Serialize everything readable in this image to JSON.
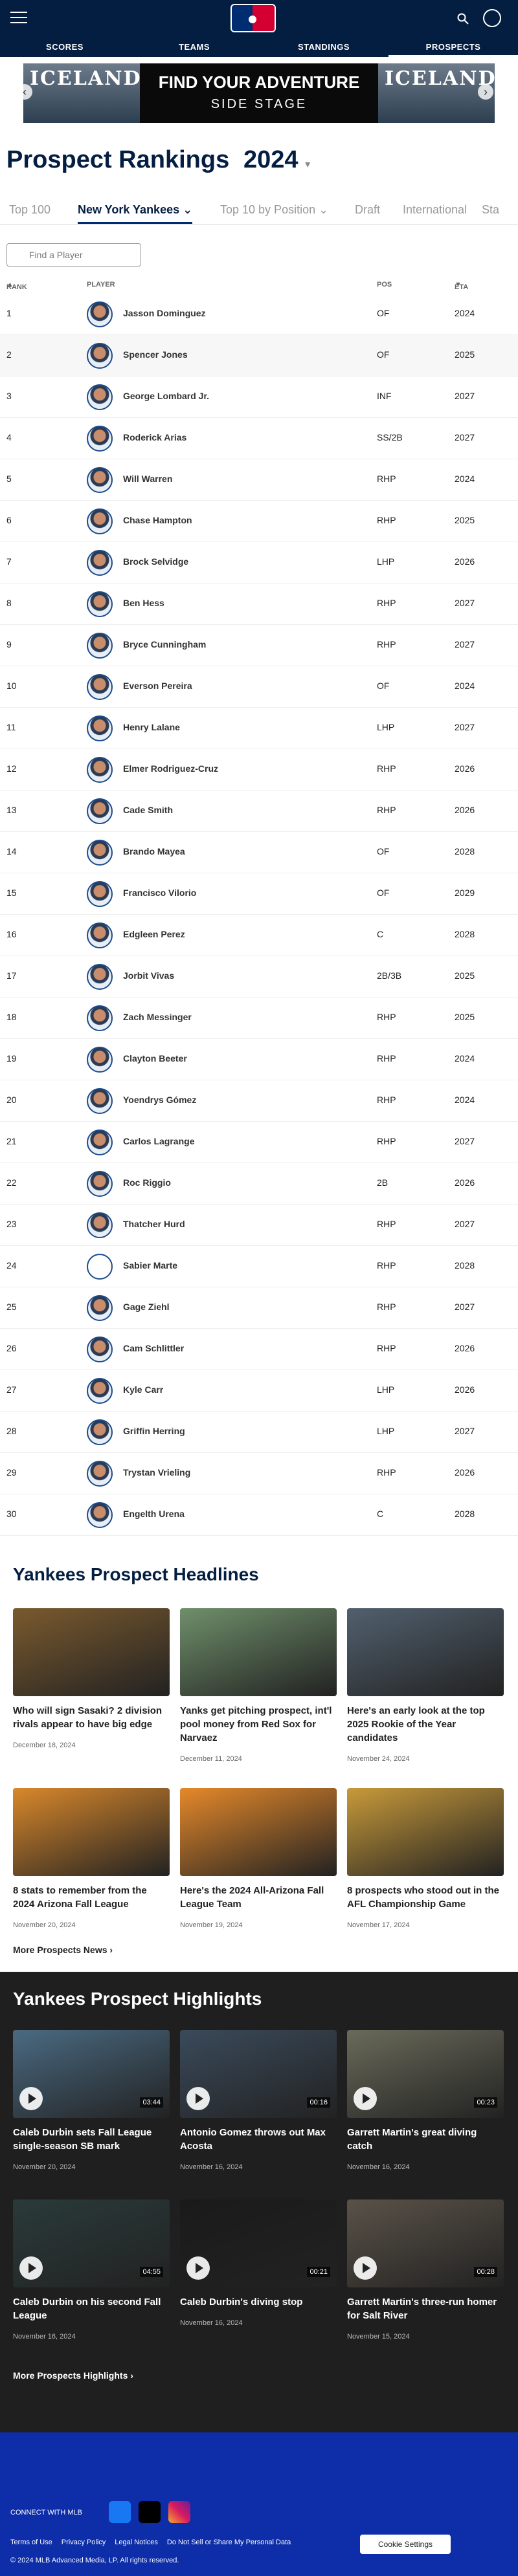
{
  "nav": {
    "items": [
      "SCORES",
      "TEAMS",
      "STANDINGS",
      "PROSPECTS"
    ],
    "active_index": 3
  },
  "banner": {
    "brand_left": "ICELAND",
    "headline": "FIND YOUR ADVENTURE",
    "sub": "SIDE STAGE",
    "brand_right": "ICELAND"
  },
  "page": {
    "title": "Prospect Rankings",
    "year": "2024"
  },
  "tabs": [
    "Top 100",
    "New York Yankees",
    "Top 10 by Position",
    "Draft",
    "International",
    "Sta"
  ],
  "search": {
    "placeholder": "Find a Player"
  },
  "table": {
    "headers": {
      "rank": "RANK",
      "player": "PLAYER",
      "pos": "POS",
      "eta": "ETA"
    },
    "rows": [
      {
        "rank": "1",
        "name": "Jasson Dominguez",
        "pos": "OF",
        "eta": "2024"
      },
      {
        "rank": "2",
        "name": "Spencer Jones",
        "pos": "OF",
        "eta": "2025"
      },
      {
        "rank": "3",
        "name": "George Lombard Jr.",
        "pos": "INF",
        "eta": "2027"
      },
      {
        "rank": "4",
        "name": "Roderick Arias",
        "pos": "SS/2B",
        "eta": "2027"
      },
      {
        "rank": "5",
        "name": "Will Warren",
        "pos": "RHP",
        "eta": "2024"
      },
      {
        "rank": "6",
        "name": "Chase Hampton",
        "pos": "RHP",
        "eta": "2025"
      },
      {
        "rank": "7",
        "name": "Brock Selvidge",
        "pos": "LHP",
        "eta": "2026"
      },
      {
        "rank": "8",
        "name": "Ben Hess",
        "pos": "RHP",
        "eta": "2027"
      },
      {
        "rank": "9",
        "name": "Bryce Cunningham",
        "pos": "RHP",
        "eta": "2027"
      },
      {
        "rank": "10",
        "name": "Everson Pereira",
        "pos": "OF",
        "eta": "2024"
      },
      {
        "rank": "11",
        "name": "Henry Lalane",
        "pos": "LHP",
        "eta": "2027"
      },
      {
        "rank": "12",
        "name": "Elmer Rodriguez-Cruz",
        "pos": "RHP",
        "eta": "2026"
      },
      {
        "rank": "13",
        "name": "Cade Smith",
        "pos": "RHP",
        "eta": "2026"
      },
      {
        "rank": "14",
        "name": "Brando Mayea",
        "pos": "OF",
        "eta": "2028"
      },
      {
        "rank": "15",
        "name": "Francisco Vilorio",
        "pos": "OF",
        "eta": "2029"
      },
      {
        "rank": "16",
        "name": "Edgleen Perez",
        "pos": "C",
        "eta": "2028"
      },
      {
        "rank": "17",
        "name": "Jorbit Vivas",
        "pos": "2B/3B",
        "eta": "2025"
      },
      {
        "rank": "18",
        "name": "Zach Messinger",
        "pos": "RHP",
        "eta": "2025"
      },
      {
        "rank": "19",
        "name": "Clayton Beeter",
        "pos": "RHP",
        "eta": "2024"
      },
      {
        "rank": "20",
        "name": "Yoendrys Gómez",
        "pos": "RHP",
        "eta": "2024"
      },
      {
        "rank": "21",
        "name": "Carlos Lagrange",
        "pos": "RHP",
        "eta": "2027"
      },
      {
        "rank": "22",
        "name": "Roc Riggio",
        "pos": "2B",
        "eta": "2026"
      },
      {
        "rank": "23",
        "name": "Thatcher Hurd",
        "pos": "RHP",
        "eta": "2027"
      },
      {
        "rank": "24",
        "name": "Sabier Marte",
        "pos": "RHP",
        "eta": "2028"
      },
      {
        "rank": "25",
        "name": "Gage Ziehl",
        "pos": "RHP",
        "eta": "2027"
      },
      {
        "rank": "26",
        "name": "Cam Schlittler",
        "pos": "RHP",
        "eta": "2026"
      },
      {
        "rank": "27",
        "name": "Kyle Carr",
        "pos": "LHP",
        "eta": "2026"
      },
      {
        "rank": "28",
        "name": "Griffin Herring",
        "pos": "LHP",
        "eta": "2027"
      },
      {
        "rank": "29",
        "name": "Trystan Vrieling",
        "pos": "RHP",
        "eta": "2026"
      },
      {
        "rank": "30",
        "name": "Engelth Urena",
        "pos": "C",
        "eta": "2028"
      }
    ]
  },
  "headlines": {
    "title": "Yankees Prospect Headlines",
    "items": [
      {
        "title": "Who will sign Sasaki? 2 division rivals appear to have big edge",
        "date": "December 18, 2024",
        "color": "#7a5a2e"
      },
      {
        "title": "Yanks get pitching prospect, int'l pool money from Red Sox for Narvaez",
        "date": "December 11, 2024",
        "color": "#6f8f6a"
      },
      {
        "title": "Here's an early look at the top 2025 Rookie of the Year candidates",
        "date": "November 24, 2024",
        "color": "#51606e"
      },
      {
        "title": "8 stats to remember from the 2024 Arizona Fall League",
        "date": "November 20, 2024",
        "color": "#d9882b"
      },
      {
        "title": "Here's the 2024 All-Arizona Fall League Team",
        "date": "November 19, 2024",
        "color": "#e5892a"
      },
      {
        "title": "8 prospects who stood out in the AFL Championship Game",
        "date": "November 17, 2024",
        "color": "#c89a3a"
      }
    ],
    "more": "More Prospects News"
  },
  "highlights": {
    "title": "Yankees Prospect Highlights",
    "items": [
      {
        "title": "Caleb Durbin sets Fall League single-season SB mark",
        "date": "November 20, 2024",
        "duration": "03:44",
        "color": "#4a6a82"
      },
      {
        "title": "Antonio Gomez throws out Max Acosta",
        "date": "November 16, 2024",
        "duration": "00:16",
        "color": "#3a4a5a"
      },
      {
        "title": "Garrett Martin's great diving catch",
        "date": "November 16, 2024",
        "duration": "00:23",
        "color": "#6a6a5a"
      },
      {
        "title": "Caleb Durbin on his second Fall League",
        "date": "November 16, 2024",
        "duration": "04:55",
        "color": "#2a3a3a"
      },
      {
        "title": "Caleb Durbin's diving stop",
        "date": "November 16, 2024",
        "duration": "00:21",
        "color": "#1a1a1a"
      },
      {
        "title": "Garrett Martin's three-run homer for Salt River",
        "date": "November 15, 2024",
        "duration": "00:28",
        "color": "#5a5248"
      }
    ],
    "more": "More Prospects Highlights"
  },
  "footer": {
    "connect": "CONNECT WITH MLB",
    "links": [
      "Terms of Use",
      "Privacy Policy",
      "Legal Notices",
      "Do Not Sell or Share My Personal Data"
    ],
    "cookie": "Cookie Settings",
    "copyright": "© 2024 MLB Advanced Media, LP. All rights reserved."
  }
}
